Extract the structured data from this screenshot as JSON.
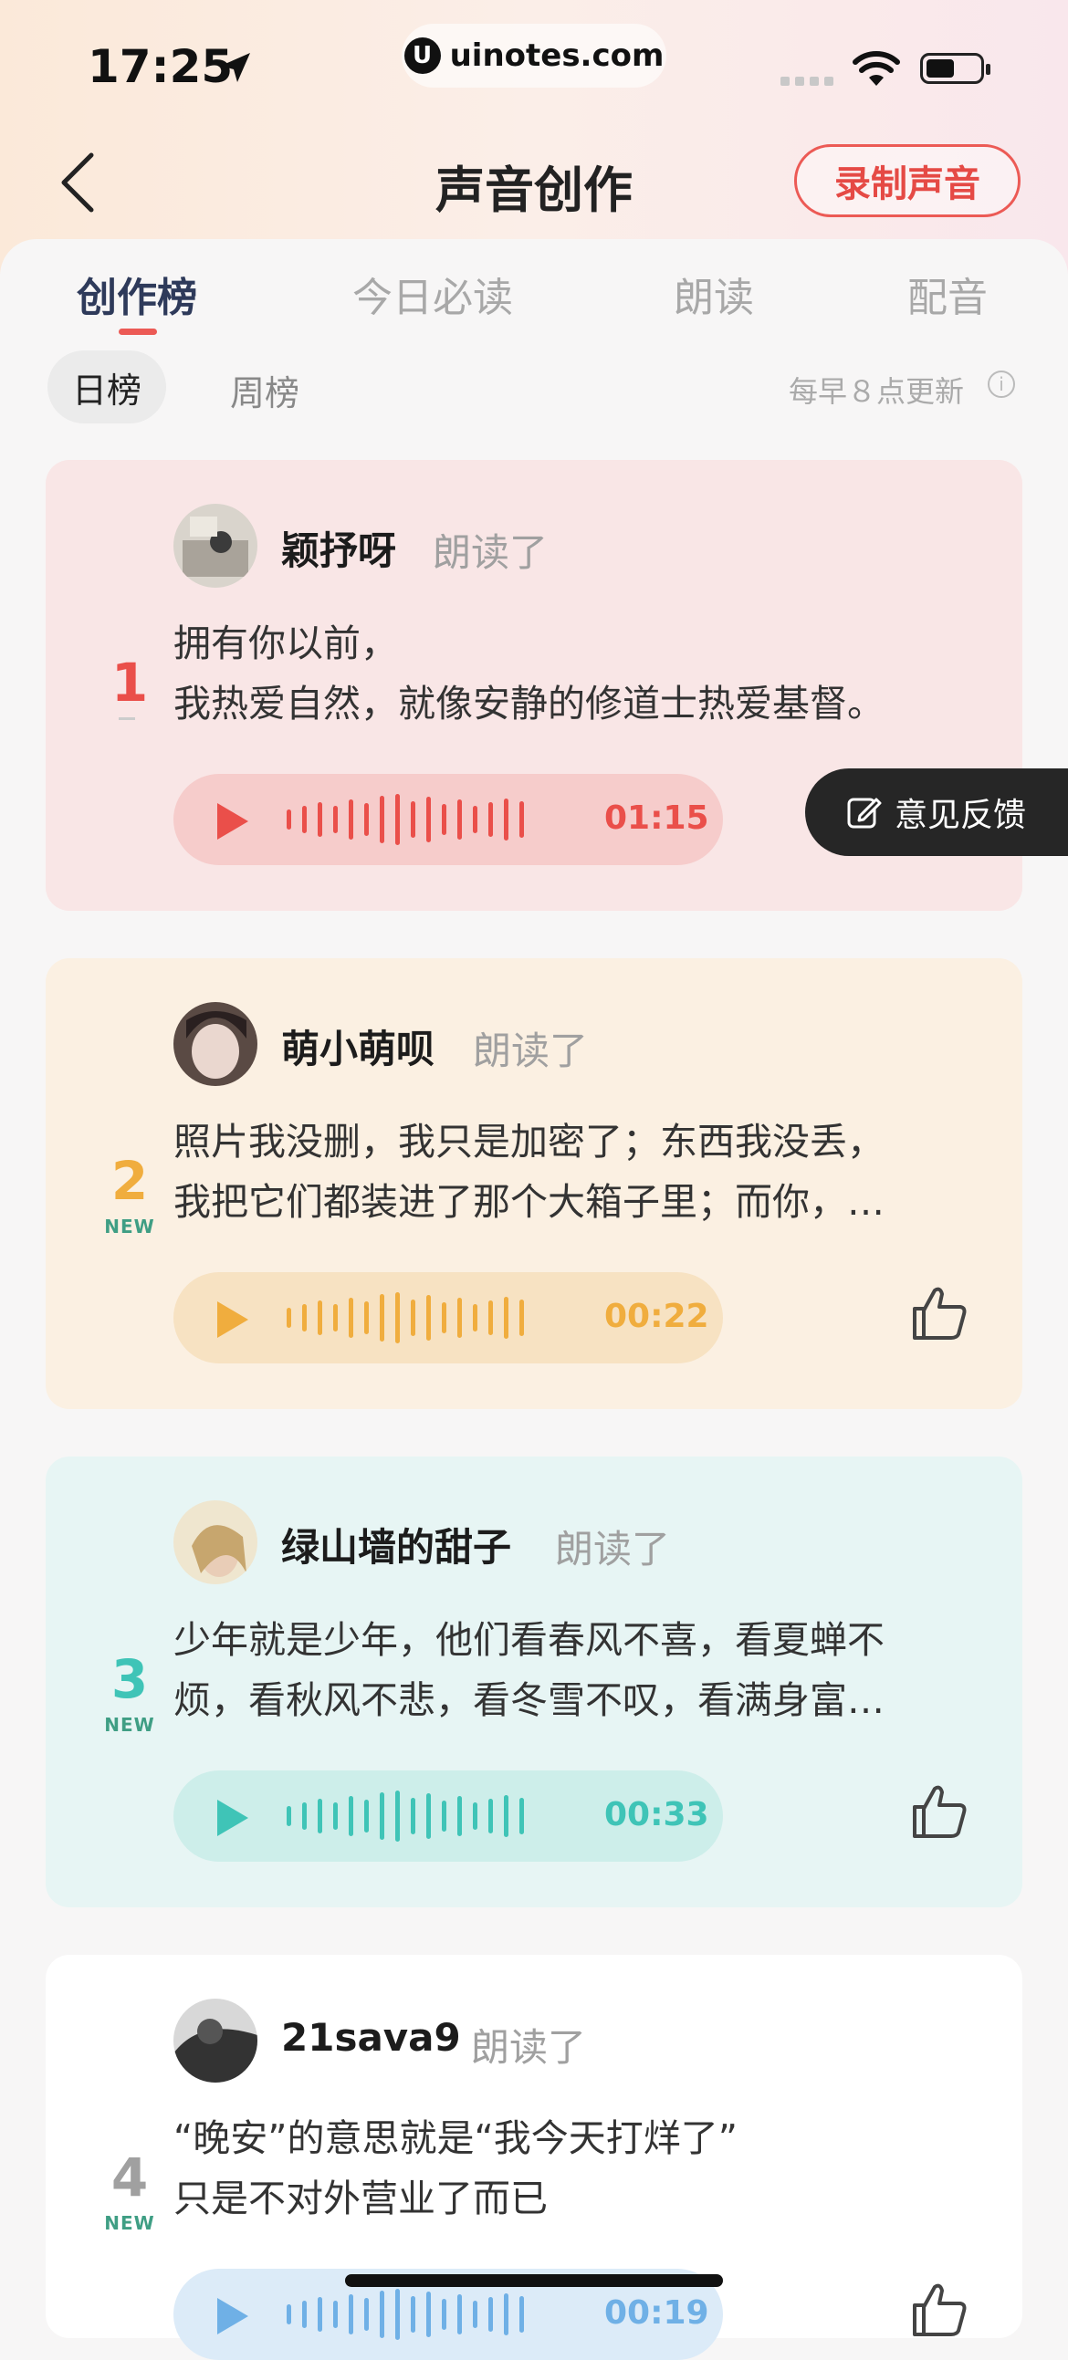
{
  "status_bar": {
    "time": "17:25",
    "url": "uinotes.com",
    "url_logo": "U"
  },
  "nav": {
    "title": "声音创作",
    "record_button": "录制声音"
  },
  "tabs": [
    {
      "label": "创作榜",
      "active": true
    },
    {
      "label": "今日必读",
      "active": false
    },
    {
      "label": "朗读",
      "active": false
    },
    {
      "label": "配音",
      "active": false
    }
  ],
  "subtabs": {
    "active": "日榜",
    "other": "周榜",
    "update_note": "每早８点更新",
    "info_icon": "i"
  },
  "feedback": {
    "label": "意见反馈"
  },
  "colors": {
    "rank1": "#ea4f4a",
    "rank2": "#f0ad3e",
    "rank3": "#3fc4b7",
    "rank4": "#a0a0a0",
    "new_badge": "#3f9e84"
  },
  "cards": [
    {
      "rank": "1",
      "new_badge": "",
      "username": "颖抒呀",
      "action": "朗读了",
      "lines": [
        "拥有你以前，",
        "我热爱自然，就像安静的修道士热爱基督。"
      ],
      "duration": "01:15",
      "liked": false
    },
    {
      "rank": "2",
      "new_badge": "NEW",
      "username": "萌小萌呗",
      "action": "朗读了",
      "lines": [
        "照片我没删，我只是加密了；东西我没丢，",
        "我把它们都装进了那个大箱子里；而你，…"
      ],
      "duration": "00:22",
      "liked": false
    },
    {
      "rank": "3",
      "new_badge": "NEW",
      "username": "绿山墙的甜子",
      "action": "朗读了",
      "lines": [
        "少年就是少年，他们看春风不喜，看夏蝉不",
        "烦，看秋风不悲，看冬雪不叹，看满身富…"
      ],
      "duration": "00:33",
      "liked": false
    },
    {
      "rank": "4",
      "new_badge": "NEW",
      "username": "21sava9",
      "action": "朗读了",
      "lines": [
        "“晚安”的意思就是“我今天打烊了”",
        "只是不对外营业了而已"
      ],
      "duration": "00:19",
      "liked": false
    }
  ]
}
